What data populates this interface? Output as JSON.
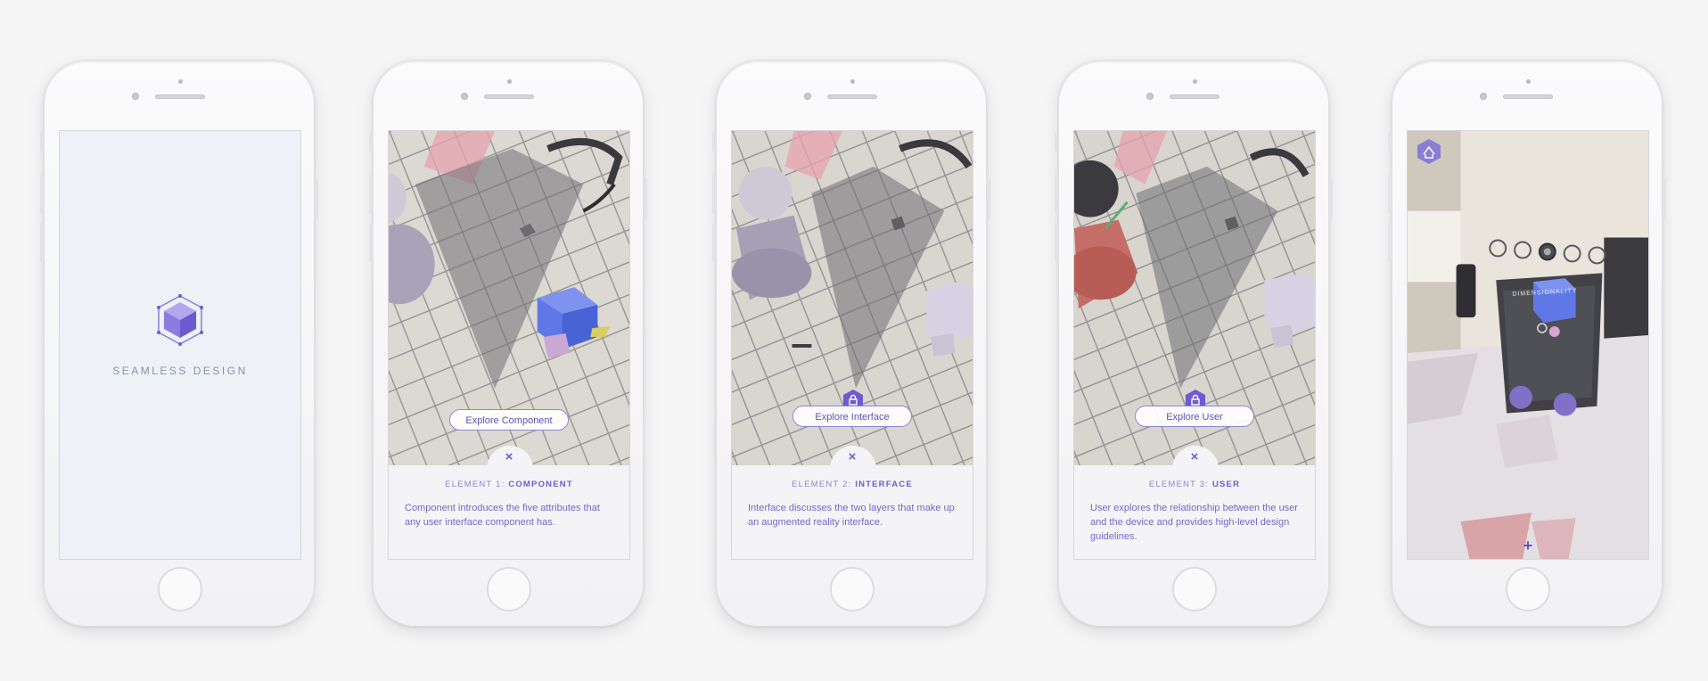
{
  "splash": {
    "title": "SEAMLESS DESIGN"
  },
  "screens": [
    {
      "element_prefix": "ELEMENT 1:",
      "element_name": "COMPONENT",
      "description": "Component introduces the five attributes that any user interface component has.",
      "explore_label": "Explore Component",
      "close_label": "×"
    },
    {
      "element_prefix": "ELEMENT 2:",
      "element_name": "INTERFACE",
      "description": "Interface discusses the two layers that make up an augmented reality interface.",
      "explore_label": "Explore Interface",
      "close_label": "×"
    },
    {
      "element_prefix": "ELEMENT 3:",
      "element_name": "USER",
      "description": "User explores the relationship between the user and the device and provides high-level design guidelines.",
      "explore_label": "Explore User",
      "close_label": "×"
    }
  ],
  "ar_room": {
    "card_label": "DIMENSIONALITY",
    "add_label": "+"
  },
  "colors": {
    "accent": "#6d5bd0",
    "cube_blue": "#5f78e6",
    "panel": "#f4f4f7",
    "splash_bg": "#eef1f6"
  }
}
